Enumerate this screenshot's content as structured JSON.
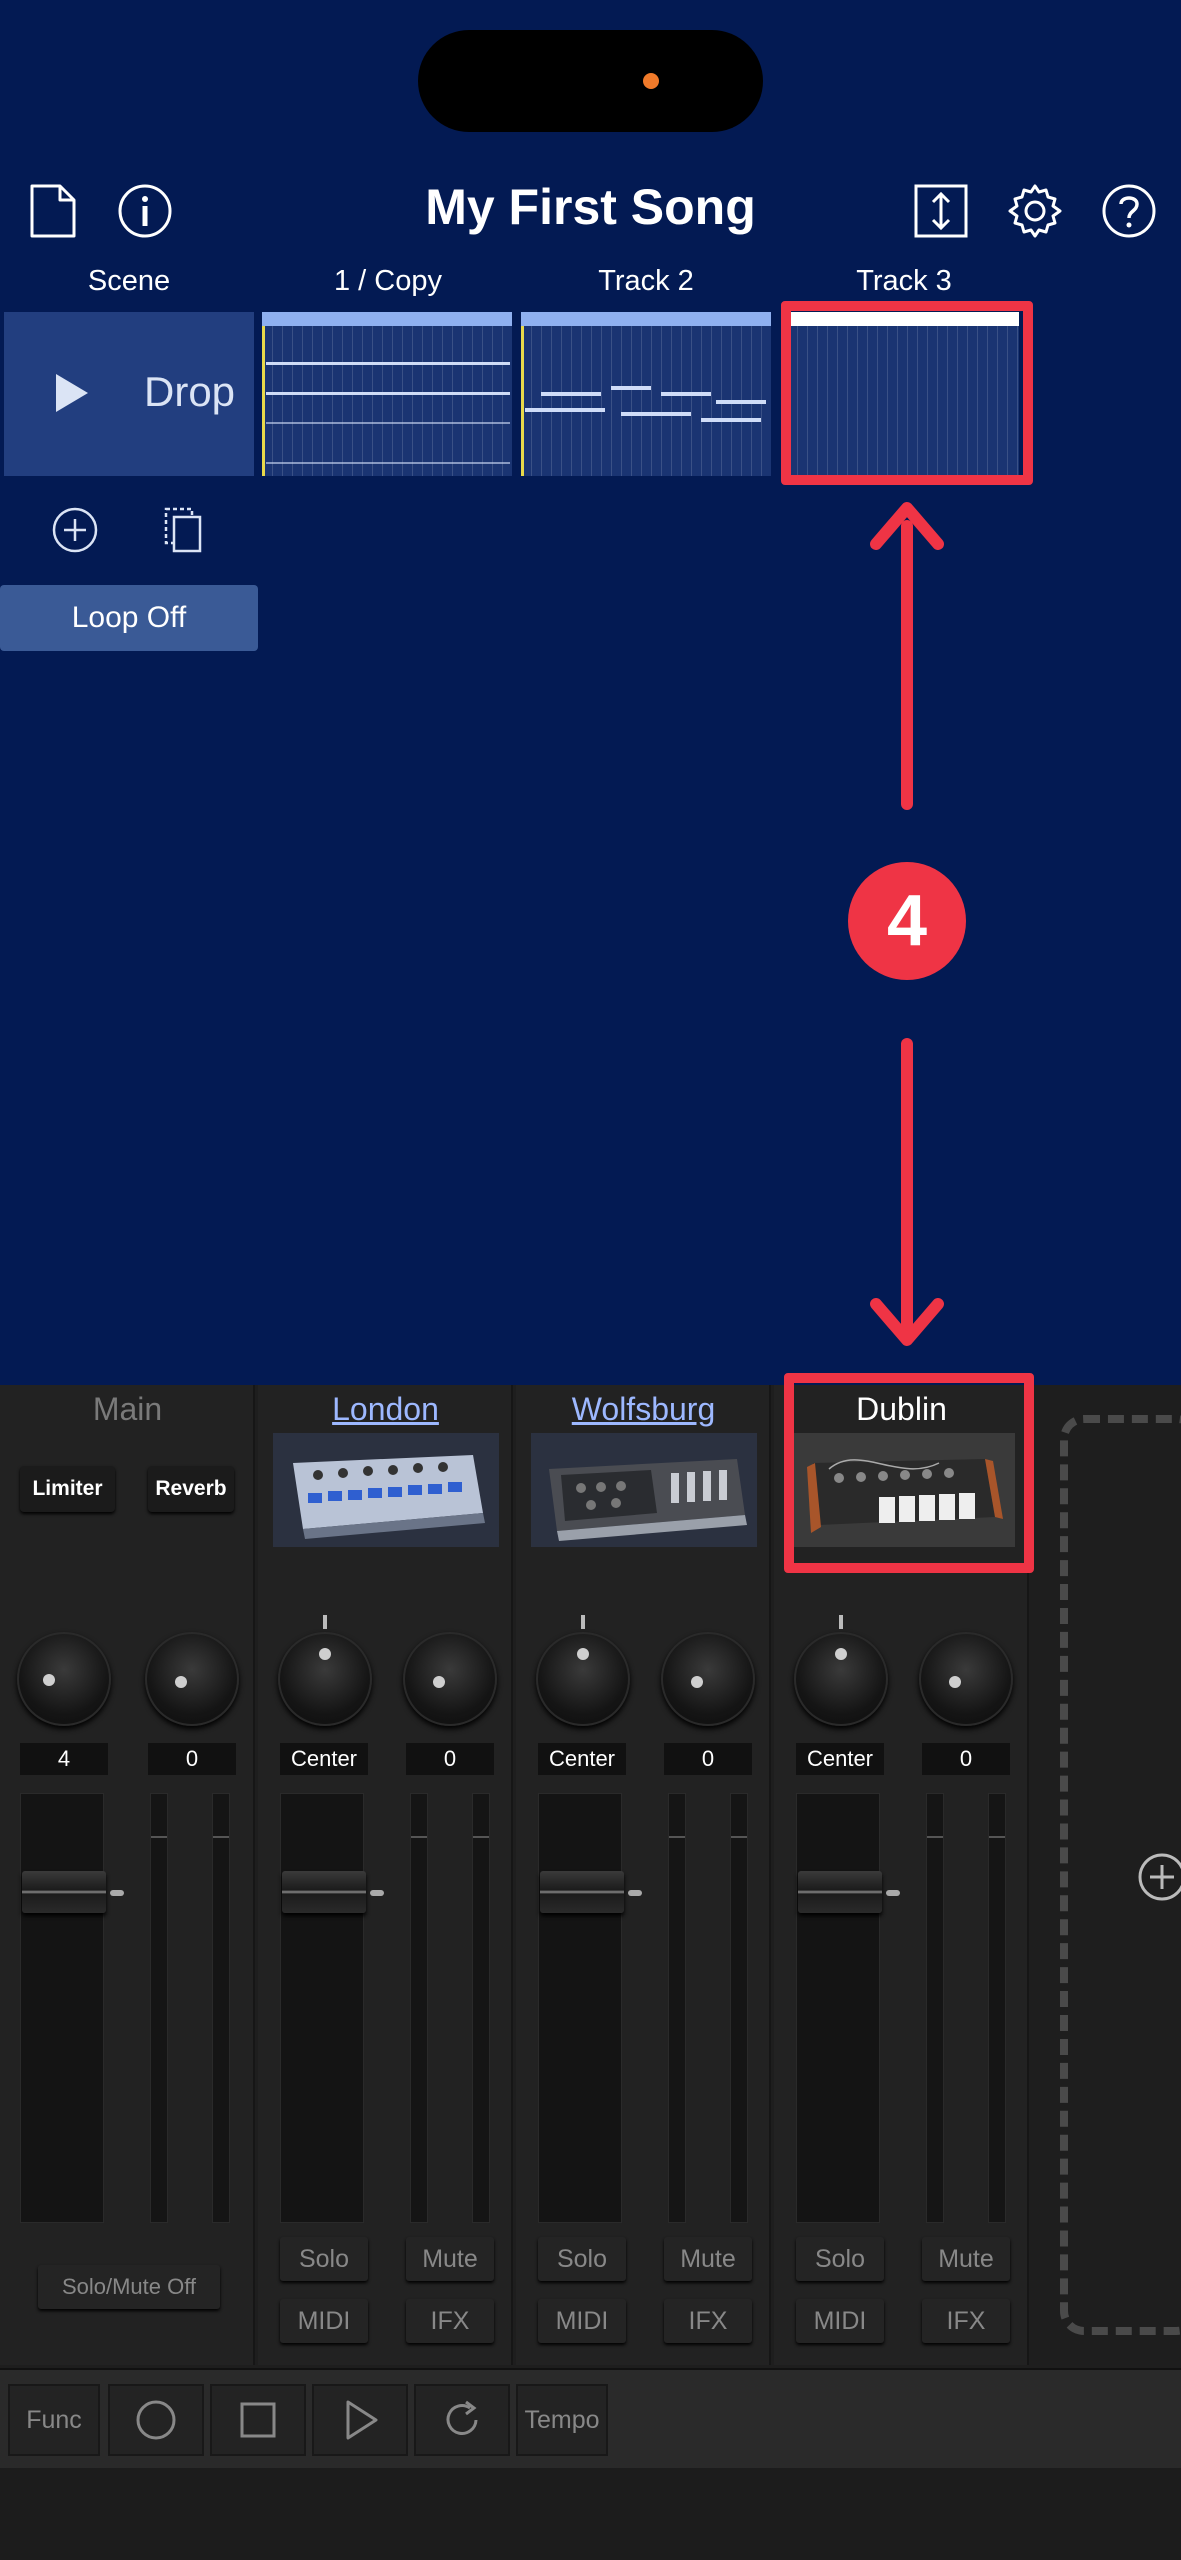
{
  "header": {
    "title": "My First Song"
  },
  "columns": {
    "scene": "Scene",
    "track1": "1 / Copy",
    "track2": "Track 2",
    "track3": "Track 3"
  },
  "scene_row": {
    "label": "Drop"
  },
  "loop_button": "Loop Off",
  "annotation": {
    "step_number": "4",
    "color": "#ef3445"
  },
  "mixer": {
    "main": {
      "name": "Main",
      "fx1": "Limiter",
      "fx2": "Reverb",
      "knob1_value": "4",
      "knob2_value": "0",
      "solo_mute": "Solo/Mute Off"
    },
    "channels": [
      {
        "name": "London",
        "pan": "Center",
        "send": "0",
        "solo": "Solo",
        "mute": "Mute",
        "midi": "MIDI",
        "ifx": "IFX"
      },
      {
        "name": "Wolfsburg",
        "pan": "Center",
        "send": "0",
        "solo": "Solo",
        "mute": "Mute",
        "midi": "MIDI",
        "ifx": "IFX"
      },
      {
        "name": "Dublin",
        "pan": "Center",
        "send": "0",
        "solo": "Solo",
        "mute": "Mute",
        "midi": "MIDI",
        "ifx": "IFX"
      }
    ]
  },
  "transport": {
    "func": "Func",
    "tempo": "Tempo"
  },
  "colors": {
    "background": "#031a53",
    "clip": "#1a3472",
    "scene_cell": "#223e7f",
    "loop_button": "#3a5a96",
    "channel_name": "#9db8ff",
    "highlight": "#ef3445"
  }
}
